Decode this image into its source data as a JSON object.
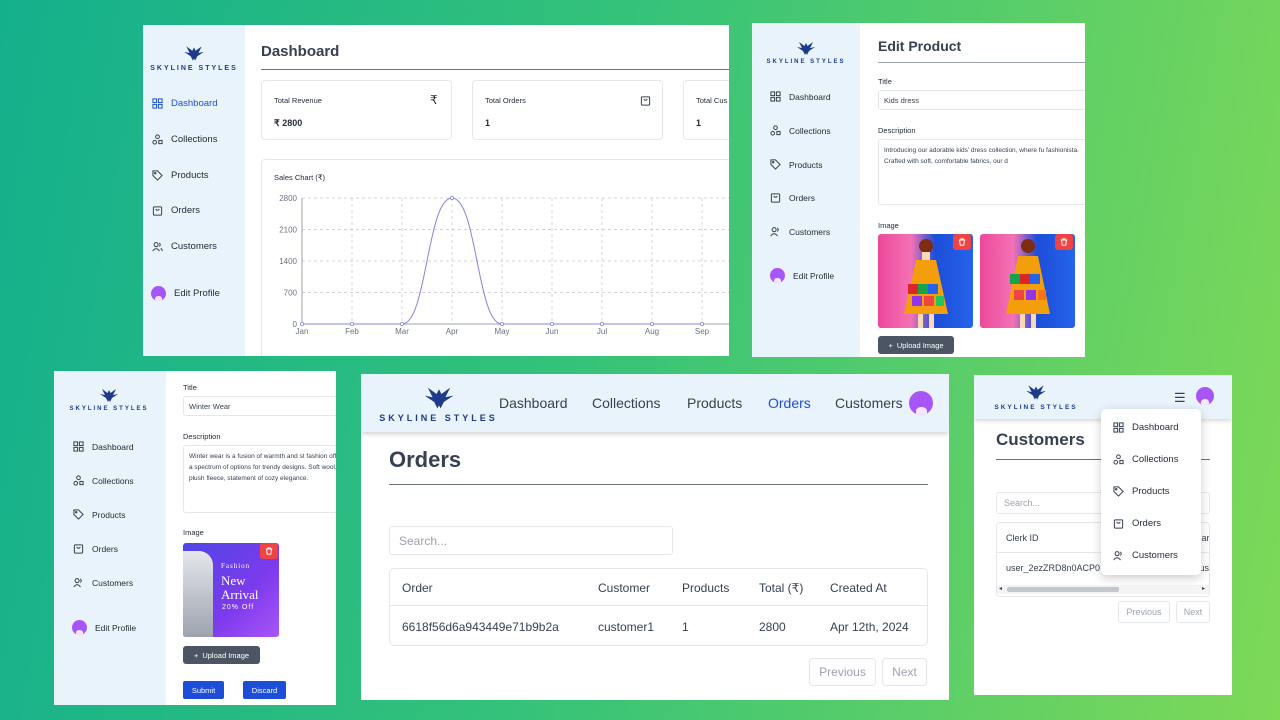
{
  "brand": {
    "name": "SKYLINE STYLES"
  },
  "nav": {
    "dashboard": "Dashboard",
    "collections": "Collections",
    "products": "Products",
    "orders": "Orders",
    "customers": "Customers",
    "edit_profile": "Edit Profile"
  },
  "dashboard": {
    "title": "Dashboard",
    "stats": [
      {
        "label": "Total Revenue",
        "value": "₹ 2800",
        "icon": "rupee-icon"
      },
      {
        "label": "Total Orders",
        "value": "1",
        "icon": "shopping-bag-icon"
      },
      {
        "label": "Total Cus",
        "value": "1",
        "icon": "users-icon"
      }
    ],
    "chart_title": "Sales Chart (₹)"
  },
  "chart_data": {
    "type": "line",
    "title": "Sales Chart (₹)",
    "categories": [
      "Jan",
      "Feb",
      "Mar",
      "Apr",
      "May",
      "Jun",
      "Jul",
      "Aug",
      "Sep"
    ],
    "series": [
      {
        "values": [
          0,
          0,
          0,
          2800,
          0,
          0,
          0,
          0,
          0
        ]
      }
    ],
    "yticks": [
      "0",
      "700",
      "1400",
      "2100",
      "2800"
    ],
    "ylim": [
      0,
      2800
    ],
    "grid": true,
    "line_color": "#8884d8"
  },
  "edit_product": {
    "title": "Edit Product",
    "title_label": "Title",
    "title_value": "Kids dress",
    "description_label": "Description",
    "description_value": "Introducing our adorable kids' dress collection, where fu fashionista. Crafted with soft, comfortable fabrics, our d",
    "image_label": "Image",
    "upload_label": "Upload Image"
  },
  "edit_collection": {
    "title_label": "Title",
    "title_value": "Winter Wear",
    "description_label": "Description",
    "description_value": "Winter wear is a fusion of warmth and st fashion offers a spectrum of options for trendy designs. Soft wool, plush fleece, statement of cozy elegance.",
    "image_label": "Image",
    "banner_line1": "Fashion",
    "banner_line2": "New",
    "banner_line3": "Arrival",
    "banner_line4": "20% Off",
    "upload_label": "Upload Image",
    "submit_label": "Submit",
    "discard_label": "Discard"
  },
  "orders": {
    "title": "Orders",
    "search_placeholder": "Search...",
    "columns": [
      "Order",
      "Customer",
      "Products",
      "Total (₹)",
      "Created At"
    ],
    "rows": [
      [
        "6618f56d6a943449e71b9b2a",
        "customer1",
        "1",
        "2800",
        "Apr 12th, 2024"
      ]
    ],
    "previous": "Previous",
    "next": "Next"
  },
  "customers": {
    "title": "Customers",
    "search_placeholder": "Search...",
    "columns": [
      "Clerk ID",
      "Nar"
    ],
    "rows": [
      [
        "user_2ezZRD8n0ACP0",
        "cus"
      ]
    ],
    "previous": "Previous",
    "next": "Next"
  },
  "colors": {
    "accent": "#1d4ed8",
    "sidebar": "#e8f3fc",
    "danger": "#ef4444",
    "avatar": "#a855f7"
  }
}
